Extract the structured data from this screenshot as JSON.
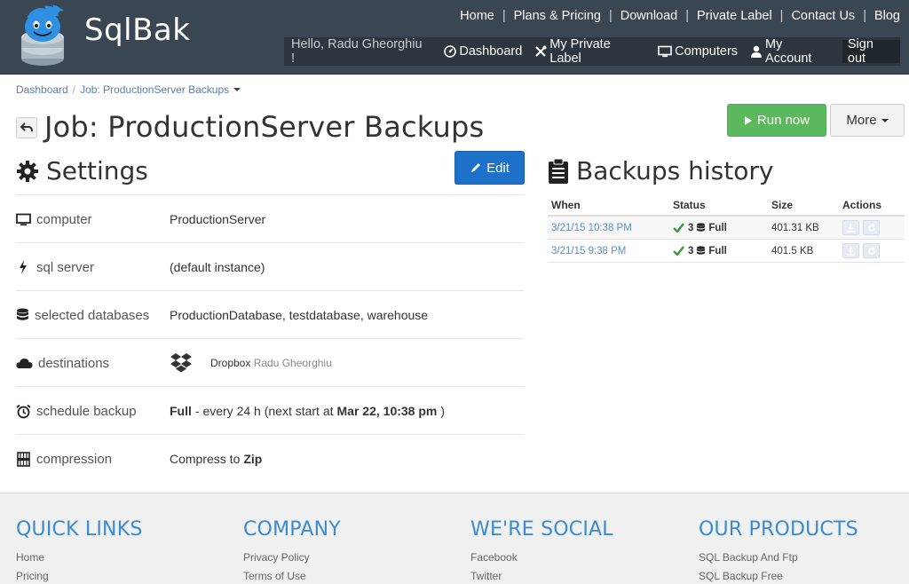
{
  "header": {
    "brand": "SqlBak",
    "nav": [
      "Home",
      "Plans & Pricing",
      "Download",
      "Private Label",
      "Contact Us",
      "Blog"
    ],
    "greeting": "Hello, Radu Gheorghiu !",
    "user_nav": {
      "dashboard": "Dashboard",
      "private_label": "My Private Label",
      "computers": "Computers",
      "account": "My Account",
      "sign_out": "Sign out"
    }
  },
  "breadcrumb": {
    "home": "Dashboard",
    "current": "Job: ProductionServer Backups"
  },
  "page": {
    "title": "Job: ProductionServer Backups",
    "run_now": "Run now",
    "more": "More"
  },
  "settings": {
    "title": "Settings",
    "edit": "Edit",
    "rows": {
      "computer": {
        "label": "computer",
        "value": "ProductionServer"
      },
      "sql_server": {
        "label": "sql server",
        "value": "(default instance)"
      },
      "databases": {
        "label": "selected databases",
        "value": "ProductionDatabase, testdatabase, warehouse"
      },
      "destinations": {
        "label": "destinations",
        "provider": "Dropbox",
        "account": "Radu Gheorghiu"
      },
      "schedule": {
        "label": "schedule backup",
        "type": "Full",
        "mid": "- every 24 h (next start at",
        "next": "Mar 22, 10:38 pm",
        "end": ")"
      },
      "compression": {
        "label": "compression",
        "prefix": "Compress to",
        "format": "Zip"
      }
    }
  },
  "history": {
    "title": "Backups history",
    "columns": [
      "When",
      "Status",
      "Size",
      "Actions"
    ],
    "rows": [
      {
        "when": "3/21/15 10:38 PM",
        "count": "3",
        "type": "Full",
        "size": "401.31 KB"
      },
      {
        "when": "3/21/15 9:38 PM",
        "count": "3",
        "type": "Full",
        "size": "401.5 KB"
      }
    ]
  },
  "footer": {
    "quick_links": {
      "title": "QUICK LINKS",
      "links": [
        "Home",
        "Pricing"
      ]
    },
    "company": {
      "title": "COMPANY",
      "links": [
        "Privacy Policy",
        "Terms of Use"
      ]
    },
    "social": {
      "title": "WE'RE SOCIAL",
      "links": [
        "Facebook",
        "Twitter"
      ]
    },
    "products": {
      "title": "OUR PRODUCTS",
      "links": [
        "SQL Backup And Ftp",
        "SQL Backup Free"
      ]
    }
  },
  "colors": {
    "header_bg": "#3a4651",
    "run_green": "#5cb85c",
    "edit_blue": "#1e71c9",
    "footer_heading": "#3a8bd0",
    "link_blue": "#5a8fc8"
  }
}
